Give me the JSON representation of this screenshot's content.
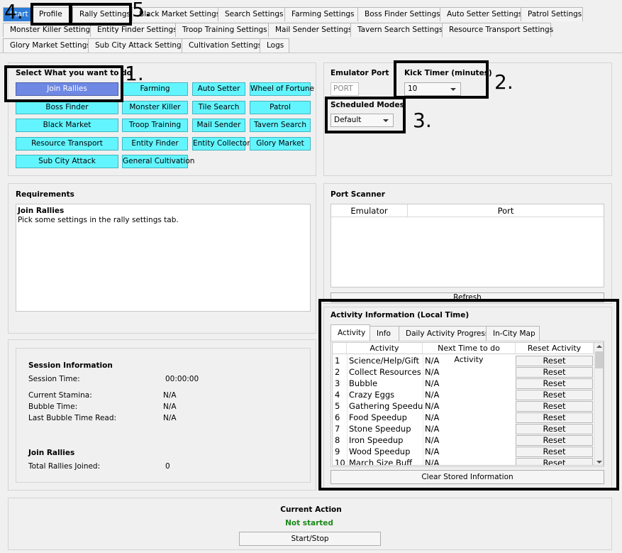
{
  "tabs_row1": [
    "Start",
    "Profile",
    "Rally Settings",
    "Black Market Settings",
    "Search Settings",
    "Farming Settings",
    "Boss Finder Settings",
    "Auto Setter Settings",
    "Patrol Settings"
  ],
  "tabs_row2": [
    "Monster Killer Settings",
    "Entity Finder Settings",
    "Troop Training Settings",
    "Mail Sender Settings",
    "Tavern Search Settings",
    "Resource Transport Settings"
  ],
  "tabs_row3": [
    "Glory Market Settings",
    "Sub City Attack Settings",
    "Cultivation Settings",
    "Logs"
  ],
  "select_mode": {
    "title": "Select What you want to do",
    "buttons": [
      "Join Rallies",
      "Farming",
      "Auto Setter",
      "Wheel of Fortune",
      "Boss Finder",
      "Monster Killer",
      "Tile Search",
      "Patrol",
      "Black Market",
      "Troop Training",
      "Mail Sender",
      "Tavern Search",
      "Resource Transport",
      "Entity Finder",
      "Entity Collector",
      "Glory Market",
      "Sub City Attack",
      "General Cultivation"
    ],
    "selected": "Join Rallies"
  },
  "emulator": {
    "port_label": "Emulator Port",
    "port_placeholder": "PORT",
    "kick_label": "Kick Timer (minutes)",
    "kick_value": "10",
    "scheduled_label": "Scheduled Modes",
    "scheduled_value": "Default"
  },
  "requirements": {
    "title": "Requirements",
    "heading": "Join Rallies",
    "text": "Pick some settings in the rally settings tab."
  },
  "port_scanner": {
    "title": "Port Scanner",
    "columns": [
      "Emulator",
      "Port"
    ],
    "refresh_label": "Refresh"
  },
  "session": {
    "title": "Session Information",
    "session_time_label": "Session Time:",
    "session_time_value": "00:00:00",
    "stamina_label": "Current Stamina:",
    "stamina_value": "N/A",
    "bubble_label": "Bubble Time:",
    "bubble_value": "N/A",
    "last_bubble_label": "Last Bubble Time Read:",
    "last_bubble_value": "N/A",
    "join_title": "Join Rallies",
    "rallies_label": "Total Rallies Joined:",
    "rallies_value": "0"
  },
  "activity": {
    "title": "Activity Information (Local Time)",
    "tabs": [
      "Activity",
      "Info",
      "Daily Activity Progress",
      "In-City Map"
    ],
    "columns": [
      "Activity",
      "Next Time to do Activity",
      "Reset Activity"
    ],
    "rows": [
      {
        "num": "1",
        "name": "Science/Help/Gift",
        "next": "N/A",
        "reset": "Reset"
      },
      {
        "num": "2",
        "name": "Collect Resources",
        "next": "N/A",
        "reset": "Reset"
      },
      {
        "num": "3",
        "name": "Bubble",
        "next": "N/A",
        "reset": "Reset"
      },
      {
        "num": "4",
        "name": "Crazy Eggs",
        "next": "N/A",
        "reset": "Reset"
      },
      {
        "num": "5",
        "name": "Gathering Speedup",
        "next": "N/A",
        "reset": "Reset"
      },
      {
        "num": "6",
        "name": "Food Speedup",
        "next": "N/A",
        "reset": "Reset"
      },
      {
        "num": "7",
        "name": "Stone Speedup",
        "next": "N/A",
        "reset": "Reset"
      },
      {
        "num": "8",
        "name": "Iron Speedup",
        "next": "N/A",
        "reset": "Reset"
      },
      {
        "num": "9",
        "name": "Wood Speedup",
        "next": "N/A",
        "reset": "Reset"
      },
      {
        "num": "10",
        "name": "March Size Buff",
        "next": "N/A",
        "reset": "Reset"
      }
    ],
    "clear_label": "Clear Stored Information"
  },
  "current_action": {
    "title": "Current Action",
    "status": "Not started",
    "status_color": "#1a8a1a",
    "button": "Start/Stop"
  },
  "annotations": [
    "1.",
    "2.",
    "3.",
    "4.",
    "5."
  ]
}
